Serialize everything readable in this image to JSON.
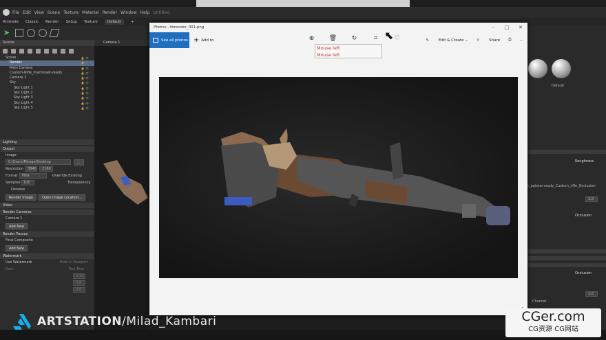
{
  "menubar": {
    "items": [
      "File",
      "Edit",
      "View",
      "Scene",
      "Texture",
      "Material",
      "Render",
      "Window",
      "Help"
    ],
    "title": "Untitled"
  },
  "tabs": [
    "Animate",
    "Classic",
    "Render",
    "Setup",
    "Texture",
    "Default",
    "+"
  ],
  "scene_panel": {
    "header": "Scene",
    "tree": [
      {
        "label": "Scene",
        "selected": false,
        "indent": 0
      },
      {
        "label": "Render",
        "selected": true,
        "indent": 1
      },
      {
        "label": "Main Camera",
        "selected": false,
        "indent": 1
      },
      {
        "label": "Custom-Rifle_marmoset-ready",
        "selected": false,
        "indent": 1
      },
      {
        "label": "Camera 1",
        "selected": false,
        "indent": 1
      },
      {
        "label": "Sky",
        "selected": false,
        "indent": 1
      },
      {
        "label": "Sky Light 1",
        "selected": false,
        "indent": 2
      },
      {
        "label": "Sky Light 2",
        "selected": false,
        "indent": 2
      },
      {
        "label": "Sky Light 3",
        "selected": false,
        "indent": 2
      },
      {
        "label": "Sky Light 4",
        "selected": false,
        "indent": 2
      },
      {
        "label": "Sky Light 5",
        "selected": false,
        "indent": 2
      }
    ]
  },
  "render_panel": {
    "lighting": "Lighting",
    "output": "Output",
    "image": "Image",
    "path": "C:/Users/Mirage/Desktop",
    "path_btn": "...",
    "resolution_label": "Resolution",
    "res_w": "3840",
    "res_h": "2160",
    "format_label": "Format",
    "format_value": "PNG",
    "override": "Override Existing",
    "samples_label": "Samples",
    "samples_value": "100",
    "transparency": "Transparency",
    "denoise": "Denoise",
    "render_image": "Render Image",
    "open_location": "Open Image Location...",
    "video": "Video",
    "render_cameras": "Render Cameras",
    "camera1": "Camera 1",
    "add_new": "Add New",
    "render_passes": "Render Passes",
    "final_composite": "Final Composite",
    "add_new2": "Add New",
    "watermark": "Watermark",
    "use_watermark": "Use Watermark",
    "hide_in_viewport": "Hide in Viewport",
    "dark": "Dark",
    "two_tone": "Two-Tone",
    "wm_v1": "0.15",
    "wm_v2": "0.8",
    "wm_v3": "0.8"
  },
  "viewport": {
    "camera": "Camera 1"
  },
  "material_panel": {
    "default_label": "Default",
    "roughness": "Roughness",
    "occlusion": "Occlusion",
    "texture_line": "e_painter-ready_Custom_rifle_Occlusion",
    "val": "1.0",
    "channel": "Channel"
  },
  "photos": {
    "title": "Photos - tbrender_001.png",
    "see_all": "See all photos",
    "add_to": "Add to",
    "edit_create": "Edit & Create",
    "share": "Share",
    "tooltip": [
      "Mouse left",
      "Mouse left"
    ]
  },
  "watermark": {
    "artstation": "ARTSTATION",
    "user": "/Milad_Kambari"
  },
  "cger": {
    "big": "CGer.com",
    "small": "CG资源 CG网站"
  }
}
